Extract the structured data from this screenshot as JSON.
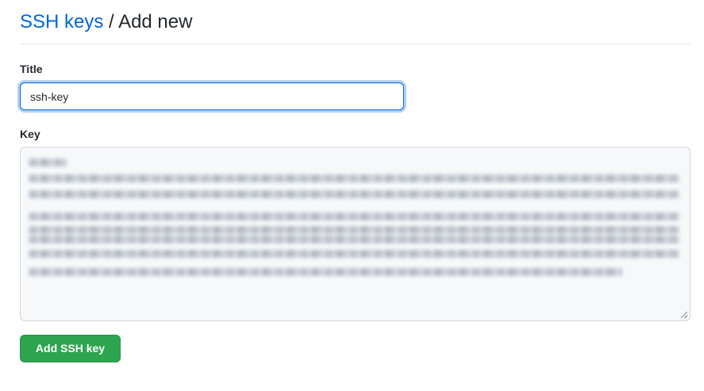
{
  "breadcrumb": {
    "parent_label": "SSH keys",
    "separator": " / ",
    "current_label": "Add new"
  },
  "form": {
    "title_label": "Title",
    "title_value": "ssh-key",
    "key_label": "Key",
    "key_value_obscured": true,
    "submit_label": "Add SSH key"
  },
  "colors": {
    "link": "#0366d6",
    "primary_button": "#2ea44f",
    "text": "#24292e",
    "textarea_bg": "#f6f8fa",
    "border": "#d1d5da"
  }
}
